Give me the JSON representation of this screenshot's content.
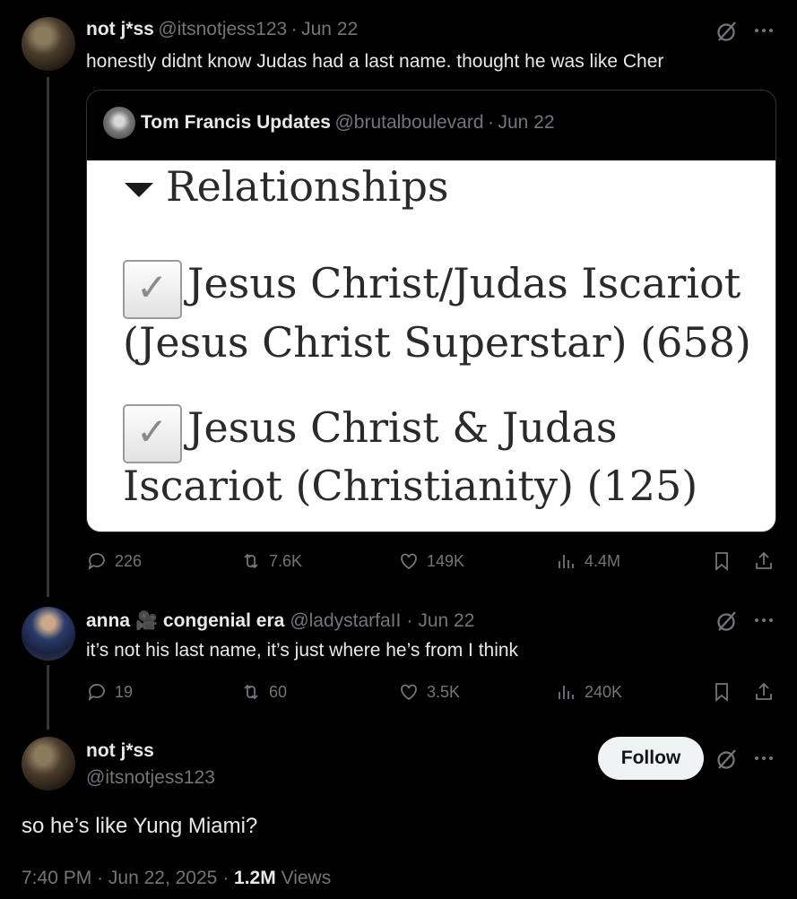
{
  "tweet1": {
    "name": "not j*ss",
    "handle": "@itsnotjess123",
    "date": "Jun 22",
    "text": "honestly didnt know Judas had a last name. thought he was like Cher",
    "quote": {
      "name": "Tom Francis Updates",
      "handle": "@brutalboulevard",
      "date": "Jun 22",
      "image": {
        "heading": "Relationships",
        "item1_line1": "Jesus Christ/Judas Iscariot",
        "item1_line2": "(Jesus Christ Superstar) (658)",
        "item2_line1": "Jesus Christ & Judas",
        "item2_line2": "Iscariot (Christianity) (125)"
      }
    },
    "stats": {
      "replies": "226",
      "reposts": "7.6K",
      "likes": "149K",
      "views": "4.4M"
    }
  },
  "tweet2": {
    "name": "anna",
    "name_suffix": "congenial era",
    "handle": "@ladystarfaII",
    "date": "Jun 22",
    "text": "it’s not his last name, it’s just where he’s from I think",
    "stats": {
      "replies": "19",
      "reposts": "60",
      "likes": "3.5K",
      "views": "240K"
    }
  },
  "tweet3": {
    "name": "not j*ss",
    "handle": "@itsnotjess123",
    "follow_label": "Follow",
    "text": "so he’s like Yung Miami?",
    "time": "7:40 PM",
    "date": "Jun 22, 2025",
    "views_count": "1.2M",
    "views_label": "Views"
  },
  "icons": {
    "grok": "grok-icon",
    "more": "more-icon",
    "reply": "reply-icon",
    "repost": "repost-icon",
    "like": "heart-icon",
    "views": "views-icon",
    "bookmark": "bookmark-icon",
    "share": "share-icon"
  }
}
